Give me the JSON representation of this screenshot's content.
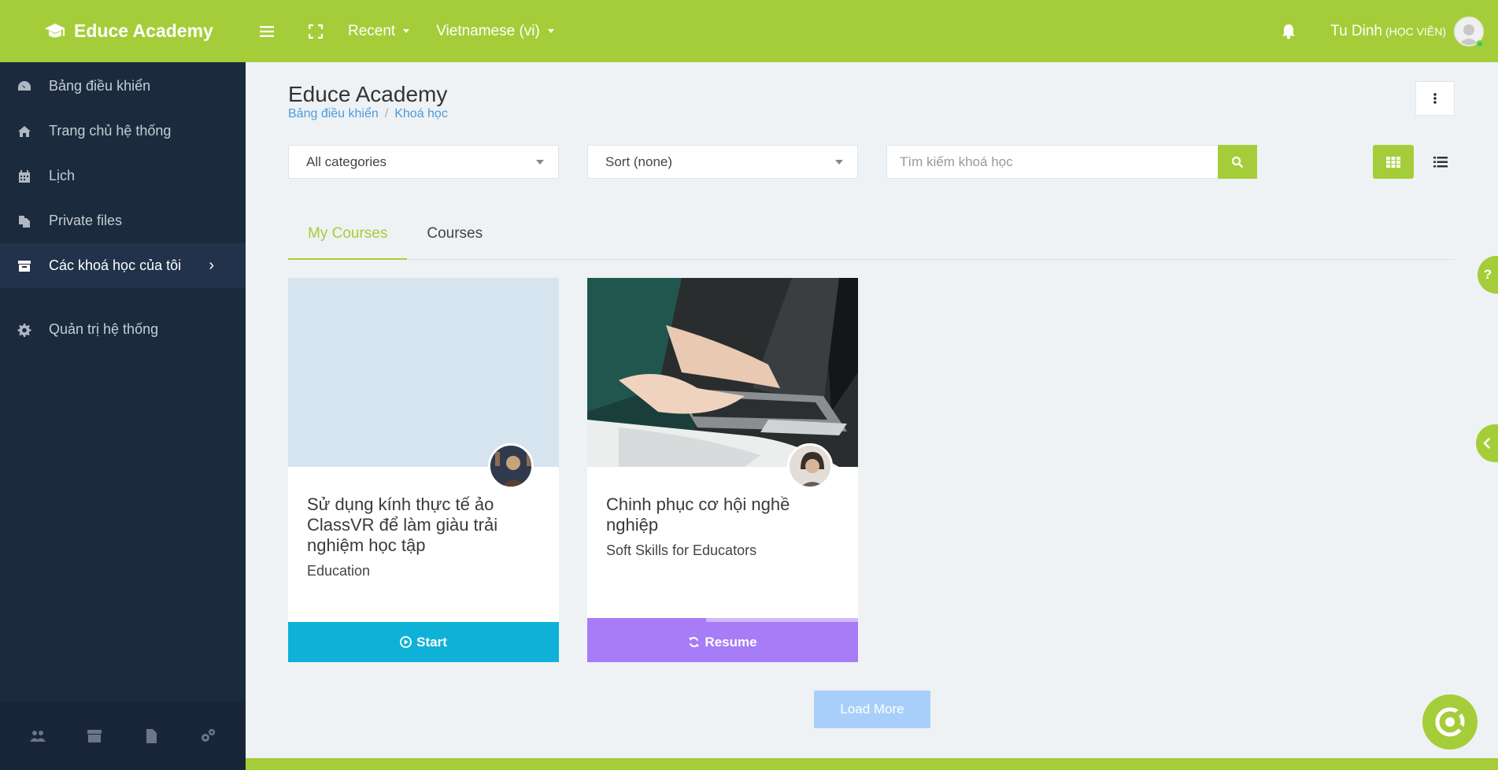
{
  "header": {
    "brand": "Educe Academy",
    "recent_label": "Recent",
    "language_label": "Vietnamese (vi)",
    "user_name": "Tu Dinh",
    "user_role": "(HỌC VIÊN)"
  },
  "sidebar": {
    "items": [
      {
        "label": "Bảng điều khiển",
        "icon": "dashboard-icon"
      },
      {
        "label": "Trang chủ hệ thống",
        "icon": "home-icon"
      },
      {
        "label": "Lịch",
        "icon": "calendar-icon"
      },
      {
        "label": "Private files",
        "icon": "files-icon"
      },
      {
        "label": "Các khoá học của tôi",
        "icon": "archive-icon"
      },
      {
        "label": "Quản trị hệ thống",
        "icon": "gear-icon"
      }
    ]
  },
  "page": {
    "title": "Educe Academy",
    "breadcrumb": [
      "Bảng điều khiển",
      "Khoá học"
    ]
  },
  "filters": {
    "category": "All categories",
    "sort": "Sort (none)",
    "search_placeholder": "Tìm kiếm khoá học"
  },
  "tabs": [
    "My Courses",
    "Courses"
  ],
  "courses": [
    {
      "title": "Sử dụng kính thực tế ảo ClassVR để làm giàu trải nghiệm học tập",
      "category": "Education",
      "action": "Start",
      "action_color": "#0fb1d7"
    },
    {
      "title": "Chinh phục cơ hội nghề nghiệp",
      "category": "Soft Skills for Educators",
      "action": "Resume",
      "action_color": "#a77cf6",
      "progress": 0.44
    }
  ],
  "load_more": "Load More",
  "help_label": "?",
  "colors": {
    "brand": "#a5cd39",
    "sidebar": "#1c2a3d",
    "link": "#4a9be0"
  }
}
